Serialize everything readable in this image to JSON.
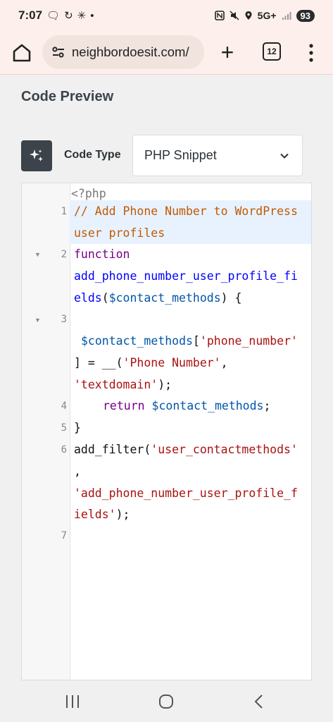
{
  "status_bar": {
    "time": "7:07",
    "network": "5G+",
    "battery": "93",
    "left_icons": [
      "chat-bubble-icon",
      "sync-icon",
      "pinwheel-icon",
      "dot-icon"
    ],
    "right_icons": [
      "nfc-icon",
      "mute-icon",
      "location-icon",
      "signal-icon"
    ]
  },
  "browser": {
    "url": "neighbordoesit.com/",
    "tab_count": "12"
  },
  "page": {
    "title": "Code Preview",
    "code_type_label": "Code Type",
    "code_type_value": "PHP Snippet"
  },
  "editor": {
    "opening_tag": "<?php",
    "line_numbers": [
      "1",
      "2",
      "3",
      "4",
      "5",
      "6",
      "7"
    ],
    "lines": {
      "l1a": "// Add Phone Number to WordPress",
      "l1b": "user profiles",
      "l2a": "function",
      "l2b": "add_phone_number_user_profile_fi",
      "l2c_def": "elds",
      "l2c_paren": "(",
      "l2c_var": "$contact_methods",
      "l2c_rest": ") {",
      "l3a_var": "$contact_methods",
      "l3a_br": "[",
      "l3a_str": "'phone_number'",
      "l3b_a": "] = __(",
      "l3b_str": "'Phone Number'",
      "l3b_c": ",",
      "l3c_str": "'textdomain'",
      "l3c_end": ");",
      "l4_kw": "return",
      "l4_var": "$contact_methods",
      "l4_end": ";",
      "l5": "}",
      "l6a": "add_filter(",
      "l6a_str": "'user_contactmethods'",
      "l6b": ",",
      "l6c_str": "'add_phone_number_user_profile_f",
      "l6d_str": "ields'",
      "l6d_end": ");"
    }
  },
  "colors": {
    "comment": "#c05a00",
    "keyword": "#770088",
    "def": "#0000ff",
    "variable": "#0055aa",
    "string": "#aa1111",
    "highlight": "#e8f2ff",
    "chrome_bg": "#fdf0ec"
  }
}
